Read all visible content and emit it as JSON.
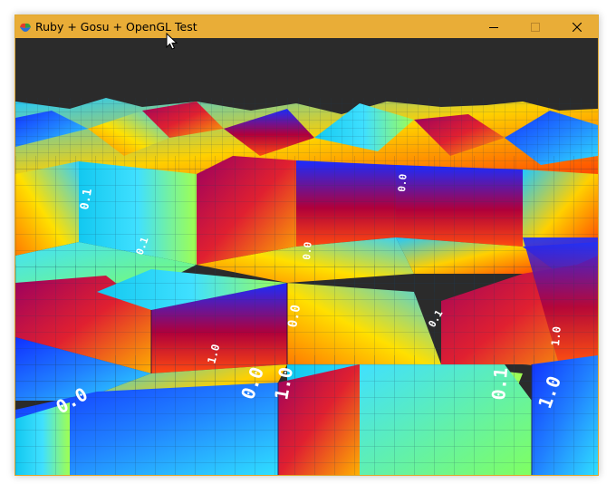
{
  "window": {
    "title": "Ruby + Gosu + OpenGL Test",
    "controls": {
      "minimize": "minimize",
      "maximize": "maximize",
      "close": "close"
    },
    "titlebar_color": "#e9ad37",
    "viewport_bg": "#2b2b2b"
  },
  "icons": {
    "app_icon": "gosu-app-icon",
    "minimize": "minimize-icon",
    "maximize": "maximize-icon",
    "close": "close-icon",
    "cursor": "mouse-pointer-icon"
  },
  "scene": {
    "labels": [
      "0.0",
      "0.0",
      "1.0",
      "0.1",
      "1.0",
      "0.0",
      "0.1",
      "0.0",
      "1.0",
      "0.1",
      "0.1",
      "1.0",
      "0.0"
    ]
  }
}
